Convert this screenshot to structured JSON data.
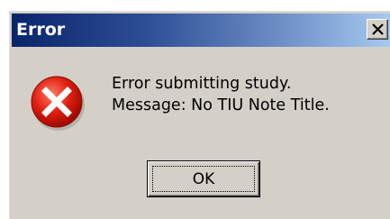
{
  "window": {
    "title": "Error"
  },
  "titlebar": {
    "close_icon": "close-x-icon"
  },
  "content": {
    "icon": "error-icon",
    "line1": "Error submitting study.",
    "line2": "Message: No TIU Note Title."
  },
  "buttons": {
    "ok_label": "OK"
  },
  "colors": {
    "titlebar_start": "#0a246a",
    "titlebar_end": "#a6caf0",
    "dialog_bg": "#d4d0c8",
    "error_red": "#e02010"
  }
}
